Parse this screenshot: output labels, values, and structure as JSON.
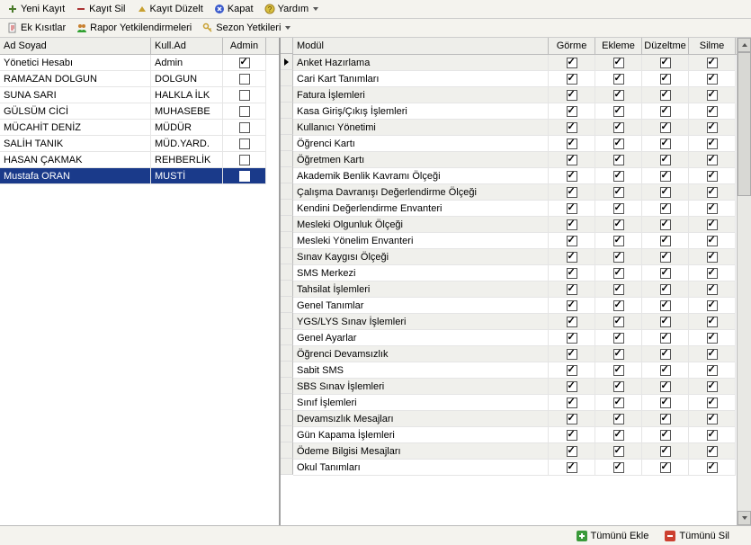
{
  "toolbar1": {
    "new": "Yeni Kayıt",
    "del": "Kayıt Sil",
    "edit": "Kayıt Düzelt",
    "close": "Kapat",
    "help": "Yardım"
  },
  "toolbar2": {
    "restrictions": "Ek Kısıtlar",
    "report_auth": "Rapor Yetkilendirmeleri",
    "season_auth": "Sezon Yetkileri"
  },
  "leftHeader": {
    "name": "Ad Soyad",
    "user": "Kull.Ad",
    "admin": "Admin"
  },
  "users": [
    {
      "name": "Yönetici Hesabı",
      "user": "Admin",
      "admin": true,
      "selected": false
    },
    {
      "name": "RAMAZAN DOLGUN",
      "user": "DOLGUN",
      "admin": false,
      "selected": false
    },
    {
      "name": "SUNA SARI",
      "user": "HALKLA İLK",
      "admin": false,
      "selected": false
    },
    {
      "name": "GÜLSÜM CİCİ",
      "user": "MUHASEBE",
      "admin": false,
      "selected": false
    },
    {
      "name": "MÜCAHİT DENİZ",
      "user": "MÜDÜR",
      "admin": false,
      "selected": false
    },
    {
      "name": "SALİH TANIK",
      "user": "MÜD.YARD.",
      "admin": false,
      "selected": false
    },
    {
      "name": "HASAN ÇAKMAK",
      "user": "REHBERLİK",
      "admin": false,
      "selected": false
    },
    {
      "name": "Mustafa ORAN",
      "user": "MUSTİ",
      "admin": true,
      "selected": true
    }
  ],
  "rightHeader": {
    "module": "Modül",
    "view": "Görme",
    "add": "Ekleme",
    "edit": "Düzeltme",
    "del": "Silme"
  },
  "modules": [
    "Anket Hazırlama",
    "Cari Kart Tanımları",
    "Fatura İşlemleri",
    "Kasa Giriş/Çıkış İşlemleri",
    "Kullanıcı Yönetimi",
    "Öğrenci Kartı",
    "Öğretmen Kartı",
    "Akademik Benlik Kavramı Ölçeği",
    "Çalışma Davranışı Değerlendirme Ölçeği",
    "Kendini Değerlendirme Envanteri",
    "Mesleki Olgunluk Ölçeği",
    "Mesleki Yönelim Envanteri",
    "Sınav Kaygısı Ölçeği",
    "SMS Merkezi",
    "Tahsilat İşlemleri",
    "Genel Tanımlar",
    "YGS/LYS Sınav İşlemleri",
    "Genel Ayarlar",
    "Öğrenci Devamsızlık",
    "Sabit SMS",
    "SBS Sınav İşlemleri",
    "Sınıf İşlemleri",
    "Devamsızlık Mesajları",
    "Gün Kapama İşlemleri",
    "Ödeme Bilgisi Mesajları",
    "Okul Tanımları"
  ],
  "footer": {
    "addAll": "Tümünü Ekle",
    "delAll": "Tümünü Sil"
  }
}
